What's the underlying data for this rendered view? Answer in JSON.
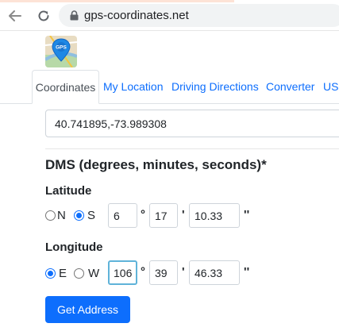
{
  "browser": {
    "url": "gps-coordinates.net"
  },
  "logo": {
    "text": "GPS"
  },
  "tabs": [
    {
      "label": "Coordinates",
      "active": true
    },
    {
      "label": "My Location",
      "active": false
    },
    {
      "label": "Driving Directions",
      "active": false
    },
    {
      "label": "Converter",
      "active": false
    },
    {
      "label": "US",
      "active": false
    }
  ],
  "coordinates": {
    "value": "40.741895,-73.989308"
  },
  "dms": {
    "title": "DMS (degrees, minutes, seconds)*",
    "latitude": {
      "label": "Latitude",
      "north_label": "N",
      "south_label": "S",
      "selected": "S",
      "degrees": "6",
      "minutes": "17",
      "seconds": "10.33"
    },
    "longitude": {
      "label": "Longitude",
      "east_label": "E",
      "west_label": "W",
      "selected": "E",
      "degrees": "106",
      "minutes": "39",
      "seconds": "46.33"
    },
    "degree_symbol": "°",
    "minute_symbol": "'",
    "second_symbol": "''"
  },
  "actions": {
    "get_address_label": "Get Address"
  },
  "colors": {
    "link": "#0d6efd",
    "button": "#0d6efd",
    "focus_border": "#5fb3d9"
  }
}
